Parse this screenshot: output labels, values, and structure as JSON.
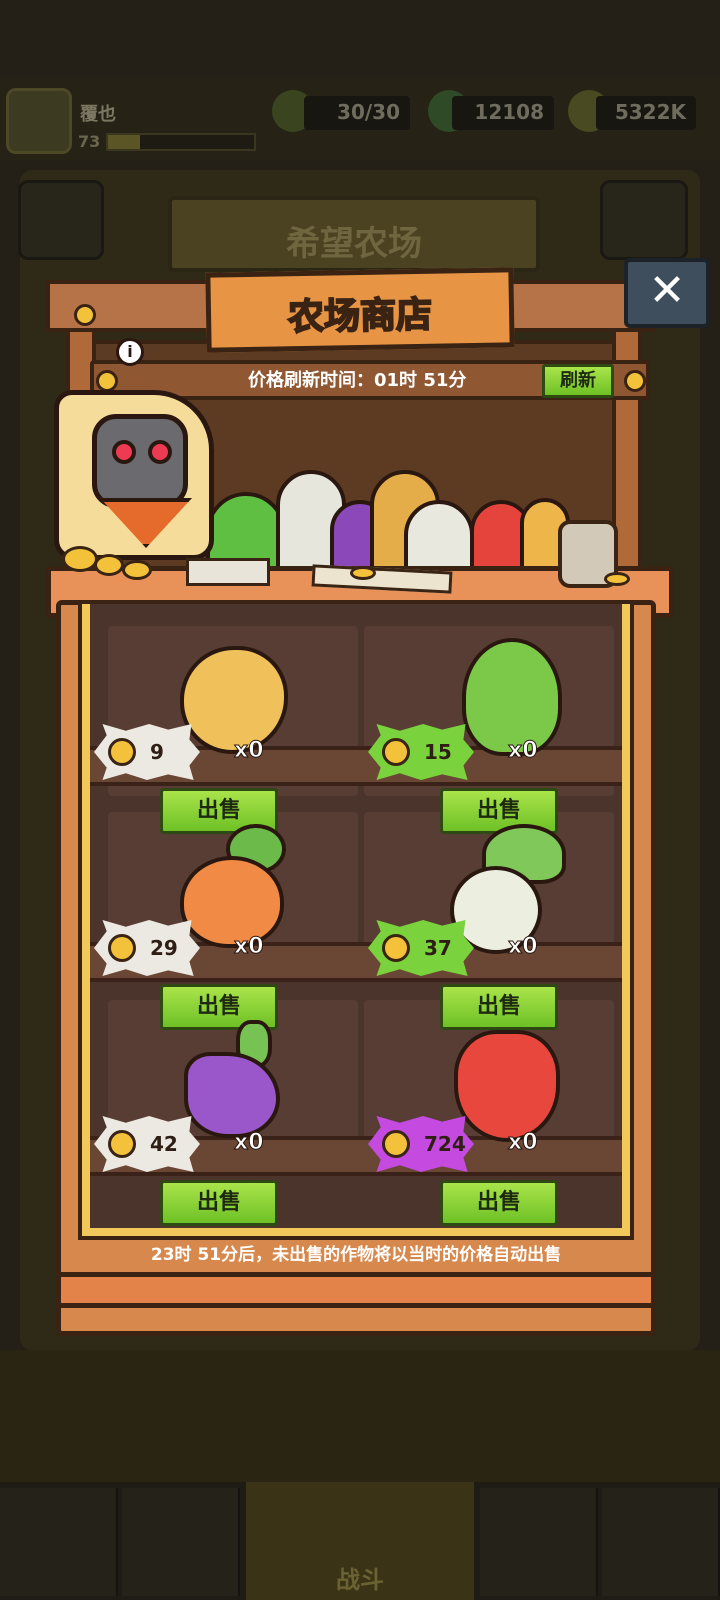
{
  "player": {
    "name": "覆也",
    "level": "73",
    "xp_fraction": 0.22
  },
  "resources": {
    "stamina": "30/30",
    "gems": "12108",
    "gold": "5322K"
  },
  "background": {
    "farm_title": "希望农场",
    "nav_fight_label": "战斗"
  },
  "shop": {
    "title": "农场商店",
    "refresh_label": "价格刷新时间：01时 51分",
    "refresh_button": "刷新",
    "info_icon_glyph": "i",
    "close_glyph": "✕",
    "footer_note": "23时 51分后，未出售的作物将以当时的价格自动出售",
    "items": [
      {
        "name": "potato",
        "price": "9",
        "qty": "x0",
        "sell_label": "出售",
        "tag_color": "#ece8e2"
      },
      {
        "name": "cabbage",
        "price": "15",
        "qty": "x0",
        "sell_label": "出售",
        "tag_color": "#7ad23c"
      },
      {
        "name": "carrot",
        "price": "29",
        "qty": "x0",
        "sell_label": "出售",
        "tag_color": "#ece8e2"
      },
      {
        "name": "turnip",
        "price": "37",
        "qty": "x0",
        "sell_label": "出售",
        "tag_color": "#7ad23c"
      },
      {
        "name": "eggplant",
        "price": "42",
        "qty": "x0",
        "sell_label": "出售",
        "tag_color": "#ece8e2"
      },
      {
        "name": "strawberry",
        "price": "724",
        "qty": "x0",
        "sell_label": "出售",
        "tag_color": "#c54ae0"
      }
    ]
  },
  "colors": {
    "sell_button": "#8ed33a",
    "panel_wood": "#d7884d",
    "frame_gold": "#f2c85b",
    "outline": "#3b2314"
  }
}
